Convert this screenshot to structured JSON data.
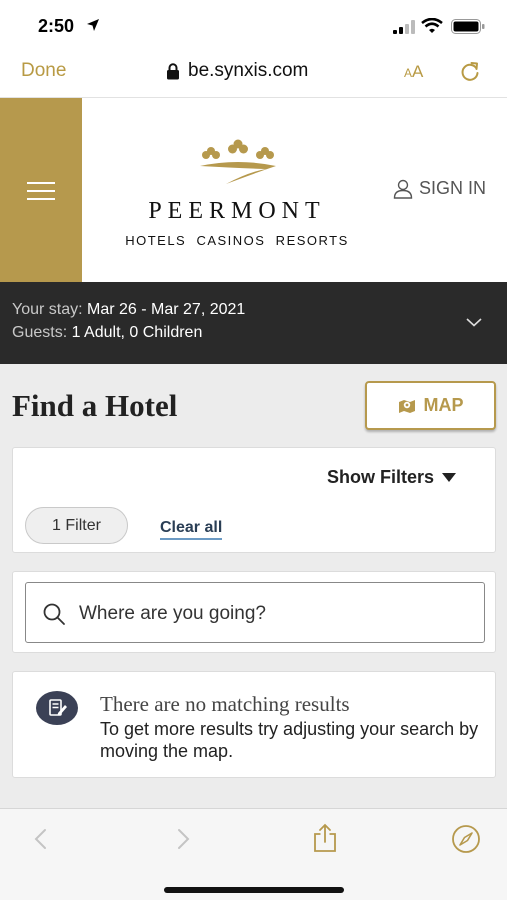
{
  "status_bar": {
    "time": "2:50",
    "icons": [
      "location-arrow-icon",
      "cellular-signal-icon",
      "wifi-icon",
      "battery-icon"
    ]
  },
  "browser": {
    "done_label": "Done",
    "url": "be.synxis.com",
    "text_size_label_small": "A",
    "text_size_label_large": "A",
    "icons": [
      "lock-icon",
      "reload-icon"
    ]
  },
  "header": {
    "brand_name": "PEERMONT",
    "brand_tagline": "HOTELS  CASINOS  RESORTS",
    "signin_label": "SIGN IN",
    "accent_color": "#b6994d"
  },
  "stay": {
    "stay_label": "Your stay:",
    "stay_value": " Mar 26 - Mar 27, 2021",
    "guests_label": "Guests:",
    "guests_value": " 1 Adult, 0 Children"
  },
  "main": {
    "title": "Find a Hotel",
    "map_button_label": "MAP",
    "filters": {
      "show_filters_label": "Show Filters",
      "filter_count_label": "1 Filter",
      "clear_all_label": "Clear all"
    },
    "search": {
      "placeholder": "Where are you going?",
      "value": ""
    },
    "results": {
      "title": "There are no matching results",
      "message": "To get more results try adjusting your search by moving the map."
    }
  },
  "toolbar": {
    "icons": [
      "back-icon",
      "forward-icon",
      "share-icon",
      "compass-icon"
    ]
  }
}
